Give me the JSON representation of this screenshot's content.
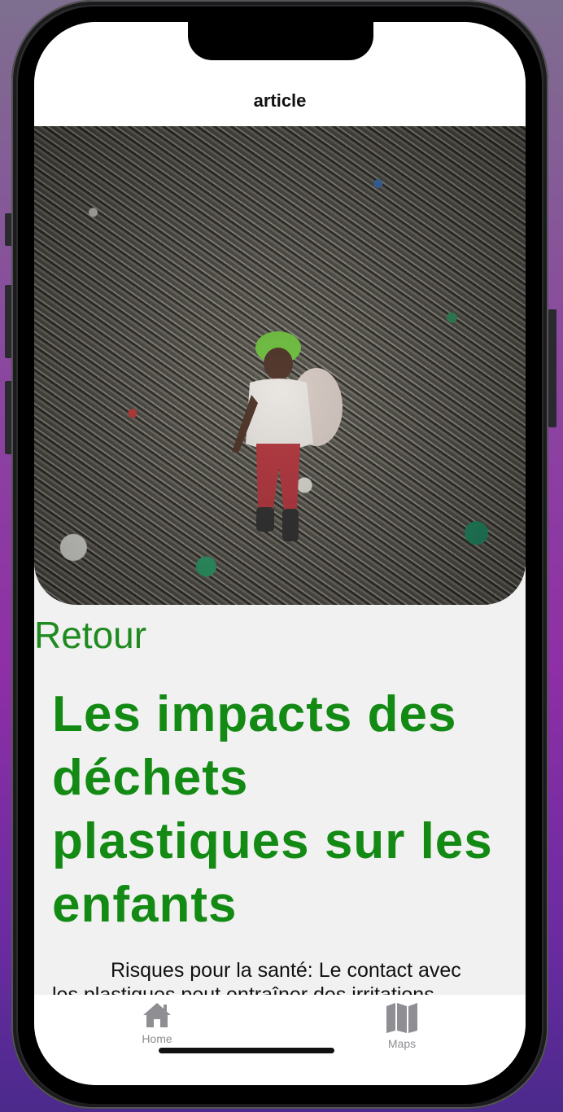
{
  "nav": {
    "title": "article"
  },
  "hero": {
    "alt": ""
  },
  "article": {
    "back_label": "Retour",
    "title": "Les impacts des déchets plastiques sur les enfants",
    "body": "Risques pour la santé: Le contact avec les plastiques peut entraîner des irritations"
  },
  "tabs": [
    {
      "label": "Home",
      "icon": "house-icon"
    },
    {
      "label": "Maps",
      "icon": "map-icon"
    }
  ],
  "colors": {
    "accent_green": "#138a13",
    "tab_gray": "#8e8e93"
  }
}
